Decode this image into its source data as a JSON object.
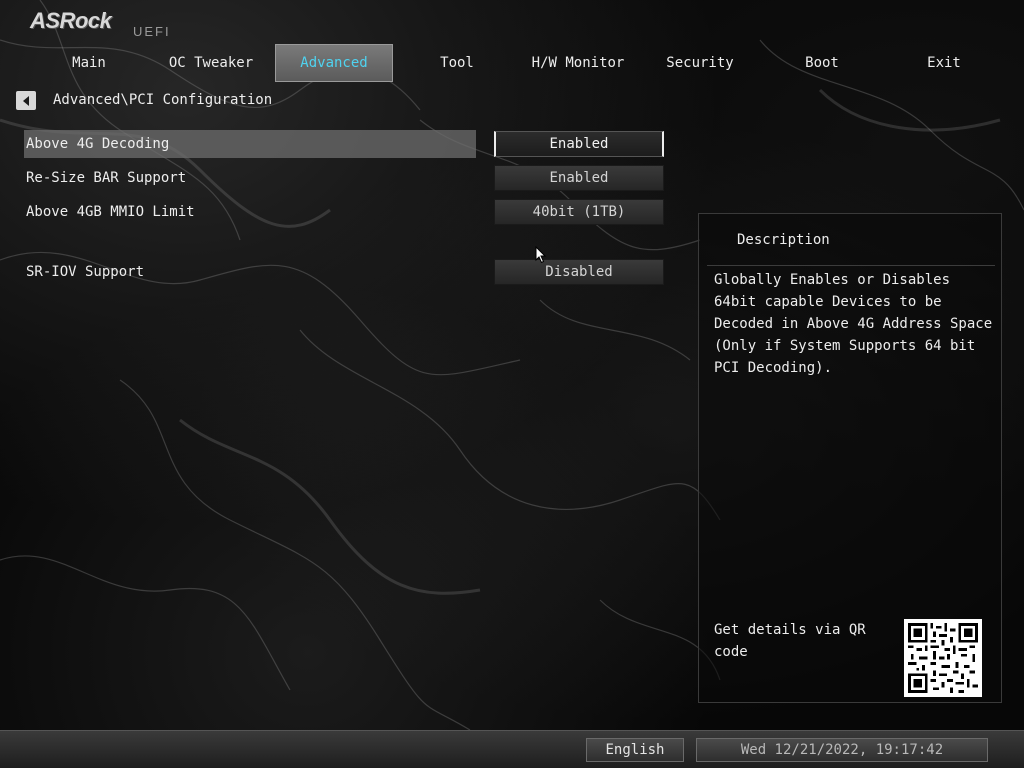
{
  "brand": {
    "logo_text": "ASRock",
    "product": "UEFI"
  },
  "tabs": [
    {
      "label": "Main",
      "active": false
    },
    {
      "label": "OC Tweaker",
      "active": false
    },
    {
      "label": "Advanced",
      "active": true
    },
    {
      "label": "Tool",
      "active": false
    },
    {
      "label": "H/W Monitor",
      "active": false
    },
    {
      "label": "Security",
      "active": false
    },
    {
      "label": "Boot",
      "active": false
    },
    {
      "label": "Exit",
      "active": false
    }
  ],
  "breadcrumb": {
    "path": "Advanced\\PCI Configuration",
    "back_icon": "left-triangle-icon"
  },
  "settings": [
    {
      "label": "Above 4G Decoding",
      "value": "Enabled",
      "selected": true
    },
    {
      "label": "Re-Size BAR Support",
      "value": "Enabled",
      "selected": false
    },
    {
      "label": "Above 4GB MMIO Limit",
      "value": "40bit (1TB)",
      "selected": false
    },
    {
      "label": "SR-IOV Support",
      "value": "Disabled",
      "selected": false
    }
  ],
  "description": {
    "title": "Description",
    "text": "Globally Enables or Disables\n64bit capable Devices to be\nDecoded in Above 4G Address Space\n(Only if System Supports 64 bit\nPCI Decoding).",
    "qr_text": "Get details via QR code"
  },
  "footer": {
    "language": "English",
    "datetime": "Wed 12/21/2022, 19:17:42"
  },
  "colors": {
    "active_tab_text": "#4fd3f0",
    "background": "#070707"
  }
}
